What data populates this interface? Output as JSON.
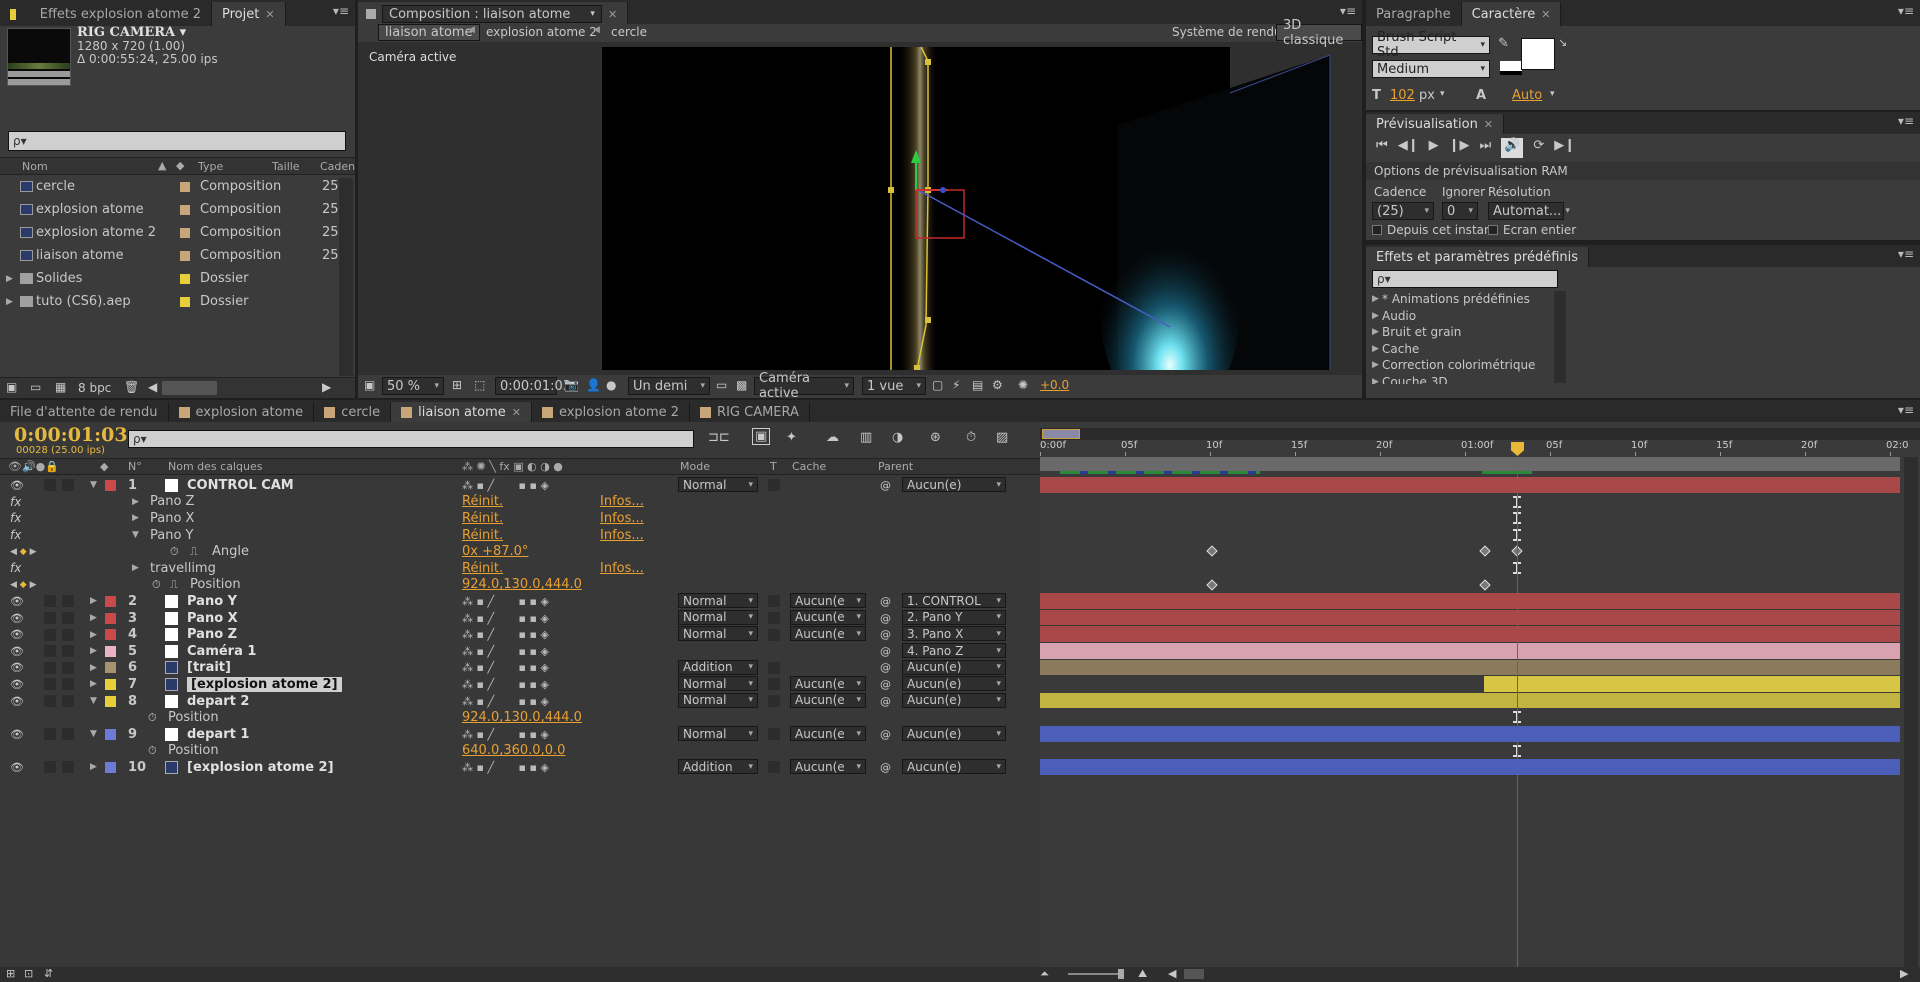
{
  "project": {
    "tab_effects": "Effets explosion atome 2",
    "tab_project": "Projet",
    "item_name": "RIG CAMERA",
    "item_dims": "1280 x 720 (1.00)",
    "item_duration": "Δ 0:00:55:24, 25.00 ips",
    "search_placeholder": "ρ▾",
    "col_name": "Nom",
    "col_type": "Type",
    "col_size": "Taille",
    "col_rate": "Cadence",
    "items": [
      {
        "name": "cercle",
        "type": "Composition",
        "rate": "25",
        "color": "#c8a67a"
      },
      {
        "name": "explosion atome",
        "type": "Composition",
        "rate": "25",
        "color": "#c8a67a"
      },
      {
        "name": "explosion atome 2",
        "type": "Composition",
        "rate": "25",
        "color": "#c8a67a"
      },
      {
        "name": "liaison atome",
        "type": "Composition",
        "rate": "25",
        "color": "#c8a67a"
      },
      {
        "name": "Solides",
        "type": "Dossier",
        "rate": "",
        "color": "#e6cf3b"
      },
      {
        "name": "tuto  (CS6).aep",
        "type": "Dossier",
        "rate": "",
        "color": "#e6cf3b"
      }
    ],
    "bpc": "8 bpc"
  },
  "comp": {
    "tab": "Composition : liaison atome",
    "crumbs": [
      "liaison atome",
      "explosion atome 2",
      "cercle"
    ],
    "renderer_label": "Système de rendu :",
    "renderer": "3D classique",
    "active_camera_label": "Caméra active",
    "zoom": "50 %",
    "timecode": "0:00:01:03",
    "resolution": "Un demi",
    "view_camera": "Caméra active",
    "views": "1 vue",
    "exposure": "+0.0"
  },
  "char": {
    "tab_para": "Paragraphe",
    "tab_char": "Caractère",
    "font": "Brush Script Std",
    "style": "Medium",
    "size": "102",
    "size_unit": "px",
    "leading": "Auto"
  },
  "preview": {
    "tab": "Prévisualisation",
    "ram_options": "Options de prévisualisation RAM",
    "rate_label": "Cadence",
    "skip_label": "Ignorer",
    "res_label": "Résolution",
    "rate": "(25)",
    "skip": "0",
    "res": "Automat...",
    "from_current": "Depuis cet instant",
    "fullscreen": "Ecran entier"
  },
  "effects": {
    "tab": "Effets et paramètres prédéfinis",
    "search": "ρ▾",
    "items": [
      "* Animations prédéfinies",
      "Audio",
      "Bruit et grain",
      "Cache",
      "Correction colorimétrique",
      "Couche 3D"
    ]
  },
  "timeline": {
    "tabs": [
      {
        "label": "File d'attente de rendu",
        "color": ""
      },
      {
        "label": "explosion atome",
        "color": "#c8a67a"
      },
      {
        "label": "cercle",
        "color": "#c8a67a"
      },
      {
        "label": "liaison atome",
        "color": "#c8a67a"
      },
      {
        "label": "explosion atome 2",
        "color": "#c8a67a"
      },
      {
        "label": "RIG CAMERA",
        "color": "#c8a67a"
      }
    ],
    "timecode": "0:00:01:03",
    "frames": "00028 (25.00 ips)",
    "search": "ρ▾",
    "col_num": "N°",
    "col_name": "Nom des calques",
    "col_mode": "Mode",
    "col_t": "T",
    "col_cache": "Cache",
    "col_parent": "Parent",
    "ruler": [
      "0:00f",
      "05f",
      "10f",
      "15f",
      "20f",
      "01:00f",
      "05f",
      "10f",
      "15f",
      "20f",
      "02:0"
    ],
    "rows": [
      {
        "kind": "layer",
        "num": "1",
        "name": "CONTROL CAM",
        "color": "#c84a4a",
        "mode": "Normal",
        "cache": "",
        "parent": "Aucun(e)",
        "bar": "#a84848"
      },
      {
        "kind": "fx",
        "name": "Pano Z",
        "v1": "Réinit.",
        "v2": "Infos..."
      },
      {
        "kind": "fx",
        "name": "Pano X",
        "v1": "Réinit.",
        "v2": "Infos..."
      },
      {
        "kind": "fx",
        "name": "Pano Y",
        "v1": "Réinit.",
        "v2": "Infos..."
      },
      {
        "kind": "prop",
        "name": "Angle",
        "v1": "0x +87.0°"
      },
      {
        "kind": "fx",
        "name": "travellimg",
        "v1": "Réinit.",
        "v2": "Infos..."
      },
      {
        "kind": "prop",
        "name": "Position",
        "v1": "924.0,130.0,444.0"
      },
      {
        "kind": "layer",
        "num": "2",
        "name": "Pano Y",
        "color": "#c84a4a",
        "mode": "Normal",
        "cache": "Aucun(e",
        "parent": "1. CONTROL",
        "bar": "#a84848"
      },
      {
        "kind": "layer",
        "num": "3",
        "name": "Pano X",
        "color": "#c84a4a",
        "mode": "Normal",
        "cache": "Aucun(e",
        "parent": "2. Pano Y",
        "bar": "#a84848"
      },
      {
        "kind": "layer",
        "num": "4",
        "name": "Pano Z",
        "color": "#c84a4a",
        "mode": "Normal",
        "cache": "Aucun(e",
        "parent": "3. Pano X",
        "bar": "#a84848"
      },
      {
        "kind": "layer",
        "num": "5",
        "name": "Caméra 1",
        "color": "#e8b3c3",
        "mode": "",
        "cache": "",
        "parent": "4. Pano Z",
        "bar": "#d9a2b1"
      },
      {
        "kind": "layer",
        "num": "6",
        "name": "[trait]",
        "color": "#a69270",
        "mode": "Addition",
        "cache": "",
        "parent": "Aucun(e)",
        "bar": "#8c7a5c"
      },
      {
        "kind": "layer",
        "num": "7",
        "name": "[explosion atome 2]",
        "color": "#e6cf3b",
        "mode": "Normal",
        "cache": "Aucun(e",
        "parent": "Aucun(e)",
        "bar": "#d6c644"
      },
      {
        "kind": "layer",
        "num": "8",
        "name": "depart 2",
        "color": "#e6cf3b",
        "mode": "Normal",
        "cache": "Aucun(e",
        "parent": "Aucun(e)",
        "bar": "#c2b440"
      },
      {
        "kind": "prop",
        "name": "Position",
        "v1": "924.0,130.0,444.0"
      },
      {
        "kind": "layer",
        "num": "9",
        "name": "depart 1",
        "color": "#6d7ad6",
        "mode": "Normal",
        "cache": "Aucun(e",
        "parent": "Aucun(e)",
        "bar": "#4b5fb8"
      },
      {
        "kind": "prop",
        "name": "Position",
        "v1": "640.0,360.0,0.0"
      },
      {
        "kind": "layer",
        "num": "10",
        "name": "[explosion atome 2]",
        "color": "#6d7ad6",
        "mode": "Addition",
        "cache": "Aucun(e",
        "parent": "Aucun(e)",
        "bar": "#4b5fb8"
      }
    ]
  }
}
